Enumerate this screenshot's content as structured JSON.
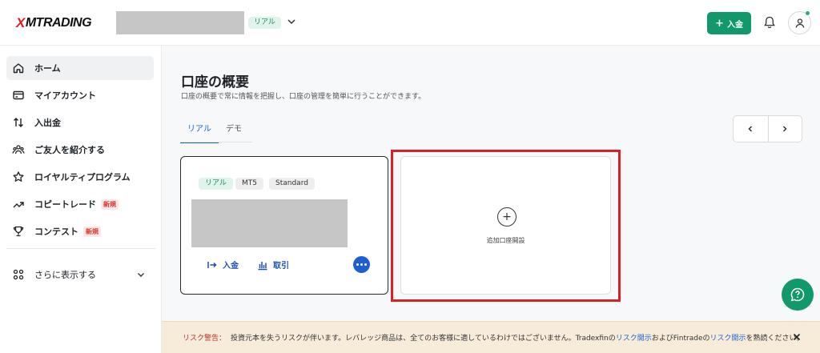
{
  "header": {
    "logo_mark": "X",
    "logo_text": "MTRADING",
    "account_badge": "リアル",
    "deposit_label": "入金",
    "deposit_icon": "plus-icon",
    "bell_icon": "bell-icon",
    "user_icon": "user-icon"
  },
  "sidebar": {
    "items": [
      {
        "label": "ホーム",
        "icon": "home-icon"
      },
      {
        "label": "マイアカウント",
        "icon": "card-icon"
      },
      {
        "label": "入出金",
        "icon": "transfer-icon"
      },
      {
        "label": "ご友人を紹介する",
        "icon": "people-icon"
      },
      {
        "label": "ロイヤルティプログラム",
        "icon": "star-icon"
      },
      {
        "label": "コピートレード",
        "icon": "trend-icon",
        "tag": "新規"
      },
      {
        "label": "コンテスト",
        "icon": "trophy-icon",
        "tag": "新規"
      }
    ],
    "more_label": "さらに表示する"
  },
  "main": {
    "title": "口座の概要",
    "subtitle": "口座の概要で常に情報を把握し、口座の管理を簡単に行うことができます。",
    "tabs": [
      {
        "label": "リアル",
        "active": true
      },
      {
        "label": "デモ",
        "active": false
      }
    ],
    "pager": {
      "prev": "‹",
      "next": "›"
    },
    "account_card": {
      "chips": [
        "リアル",
        "MT5",
        "Standard"
      ],
      "deposit_label": "入金",
      "trade_label": "取引"
    },
    "add_card": {
      "plus": "+",
      "label": "追加口座開設"
    }
  },
  "risk": {
    "label": "リスク警告：",
    "text_1": "投資元本を失うリスクが伴います。レバレッジ商品は、全てのお客様に適しているわけではございません。Tradexfinの",
    "link_1": "リスク開示",
    "text_2": "およびFintradeの",
    "link_2": "リスク開示",
    "text_3": "を熟読ください。"
  },
  "colors": {
    "brand_red": "#d81f26",
    "primary_green": "#12996b",
    "link_blue": "#1e5fd0",
    "highlight_red": "#d82127"
  }
}
